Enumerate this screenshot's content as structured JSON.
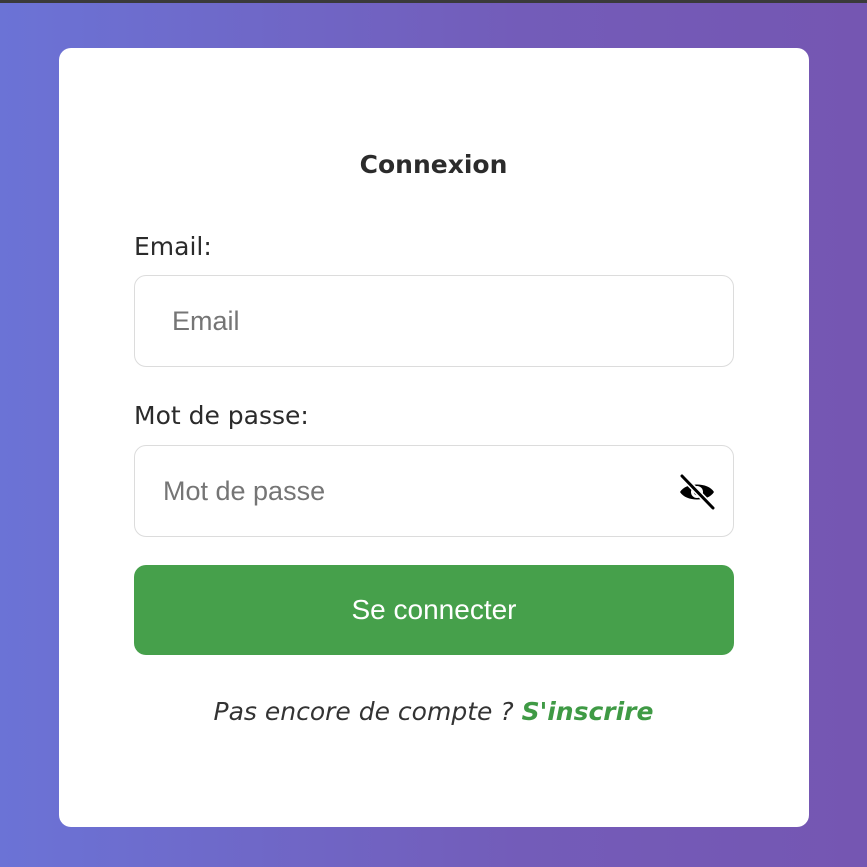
{
  "login": {
    "title": "Connexion",
    "email_label": "Email:",
    "email_placeholder": "Email",
    "email_value": "",
    "password_label": "Mot de passe:",
    "password_placeholder": "Mot de passe",
    "password_value": "",
    "password_toggle_icon": "eye-slash-icon",
    "submit_label": "Se connecter",
    "signup_prompt": "Pas encore de compte ?",
    "signup_link": "S'inscrire"
  },
  "colors": {
    "background_start": "#6b73d6",
    "background_end": "#7556b2",
    "card": "#ffffff",
    "primary_button": "#46a04b",
    "link": "#3f9a45",
    "text": "#2b2b2b"
  }
}
